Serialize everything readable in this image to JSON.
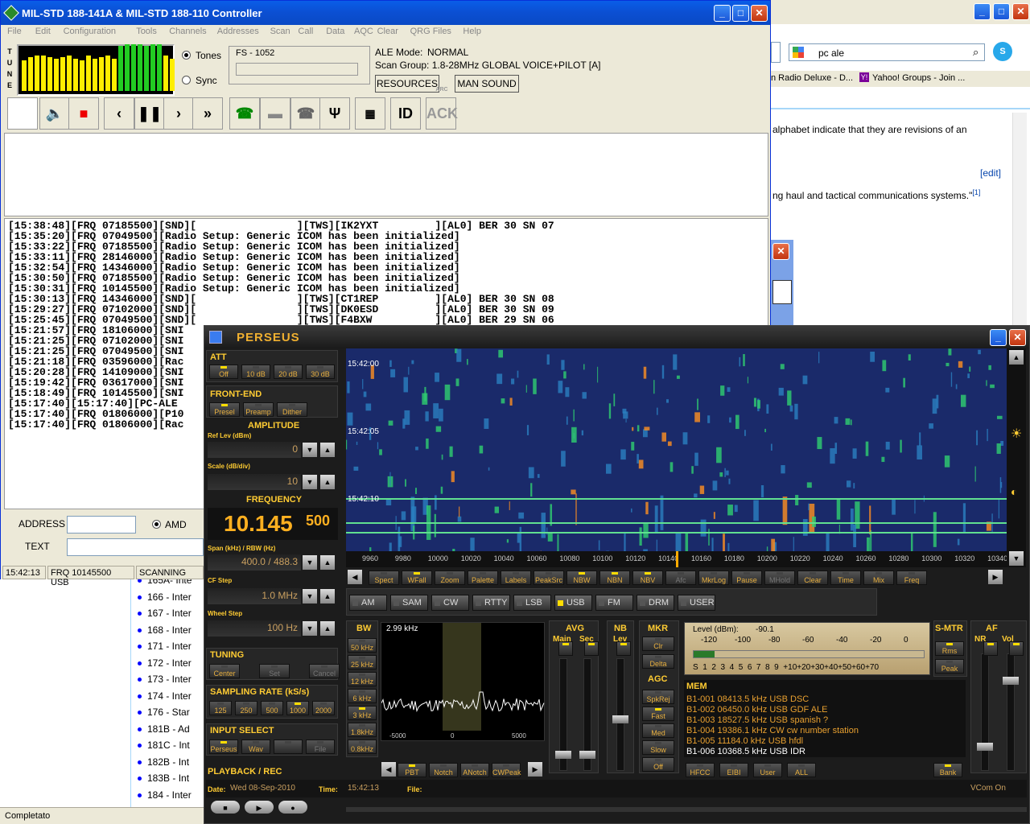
{
  "mil_window": {
    "title": "MIL-STD 188-141A & MIL-STD 188-110 Controller",
    "menu": [
      "File",
      "Edit",
      "Configuration",
      "Tools",
      "Channels",
      "Addresses",
      "Scan",
      "Call",
      "Data",
      "AQC",
      "Clear",
      "QRG Files",
      "Help"
    ],
    "tune_label": "T U N E",
    "tones_label": "Tones",
    "sync_label": "Sync",
    "fs_label": "FS - 1052",
    "ale_mode_label": "ALE Mode:",
    "ale_mode_value": "NORMAL",
    "scan_group": "Scan Group: 1.8-28MHz GLOBAL VOICE+PILOT [A]",
    "resources_btn": "RESOURCES",
    "man_sound_btn": "MAN SOUND",
    "id_btn": "ID",
    "ack_btn": "ACK",
    "ack_caption": "ARC",
    "log_lines": [
      "[15:38:48][FRQ 07185500][SND][                ][TWS][IK2YXT         ][AL0] BER 30 SN 07",
      "[15:35:20][FRQ 07049500][Radio Setup: Generic ICOM has been initialized]",
      "[15:33:22][FRQ 07185500][Radio Setup: Generic ICOM has been initialized]",
      "[15:33:11][FRQ 28146000][Radio Setup: Generic ICOM has been initialized]",
      "[15:32:54][FRQ 14346000][Radio Setup: Generic ICOM has been initialized]",
      "[15:30:50][FRQ 07185500][Radio Setup: Generic ICOM has been initialized]",
      "[15:30:31][FRQ 10145500][Radio Setup: Generic ICOM has been initialized]",
      "[15:30:13][FRQ 14346000][SND][                ][TWS][CT1REP         ][AL0] BER 30 SN 08",
      "[15:29:27][FRQ 07102000][SND][                ][TWS][DK0ESD         ][AL0] BER 30 SN 09",
      "[15:25:45][FRQ 07049500][SND][                ][TWS][F4BXW          ][AL0] BER 29 SN 06",
      "[15:21:57][FRQ 18106000][SNI",
      "[15:21:25][FRQ 07102000][SNI",
      "[15:21:25][FRQ 07049500][SNI",
      "[15:21:18][FRQ 03596000][Rac",
      "[15:20:28][FRQ 14109000][SNI",
      "[15:19:42][FRQ 03617000][SNI",
      "[15:18:49][FRQ 10145500][SNI",
      "[15:17:40][15:17:40][PC-ALE",
      "[15:17:40][FRQ 01806000][P10",
      "[15:17:40][FRQ 01806000][Rac"
    ],
    "address_label": "ADDRESS",
    "text_label": "TEXT",
    "amd_label": "AMD",
    "status": [
      "15:42:13",
      "FRQ 10145500 USB",
      "SCANNING"
    ]
  },
  "browser": {
    "search_value": "pc ale",
    "links": [
      "n Radio Deluxe - D...",
      "Yahoo! Groups - Join ..."
    ],
    "page_text_1": "alphabet indicate that they are revisions of an",
    "edit_link": "[edit]",
    "page_text_2": "ng haul and tactical communications systems.\"",
    "footnote": "[1]",
    "list_items": [
      "165A- Inte",
      "166 - Inter",
      "167 - Inter",
      "168 - Inter",
      "171 - Inter",
      "172 - Inter",
      "173 - Inter",
      "174 - Inter",
      "176 - Star",
      "181B - Ad",
      "181C - Int",
      "182B - Int",
      "183B - Int",
      "184 - Inter"
    ],
    "status_text": "Completato"
  },
  "perseus": {
    "title": "PERSEUS",
    "att_label": "ATT",
    "att_btns": [
      "Off",
      "10 dB",
      "20 dB",
      "30 dB"
    ],
    "frontend_label": "FRONT-END",
    "frontend_btns": [
      "Presel",
      "Preamp",
      "Dither"
    ],
    "amplitude_label": "AMPLITUDE",
    "ref_lev_label": "Ref Lev (dBm)",
    "ref_lev_value": "0",
    "scale_label": "Scale (dB/div)",
    "scale_value": "10",
    "frequency_label": "FREQUENCY",
    "freq_main": "10.145",
    "freq_sub": "500",
    "span_label": "Span (kHz) / RBW (Hz)",
    "span_value": "400.0 / 488.3",
    "cf_step_label": "CF Step",
    "cf_step_value": "1.0 MHz",
    "wheel_step_label": "Wheel Step",
    "wheel_step_value": "100 Hz",
    "tuning_label": "TUNING",
    "tuning_btns": [
      "Center",
      "Set",
      "Cancel"
    ],
    "sampling_label": "SAMPLING RATE (kS/s)",
    "sampling_btns": [
      "125",
      "250",
      "500",
      "1000",
      "2000"
    ],
    "input_label": "INPUT SELECT",
    "input_btns": [
      "Perseus",
      "Wav",
      "",
      "File"
    ],
    "playback_label": "PLAYBACK / REC",
    "date_label": "Date:",
    "date_value": "Wed 08-Sep-2010",
    "time_label": "Time:",
    "time_value": "15:42:13",
    "file_label": "File:",
    "vcom": "VCom On",
    "wf_times": [
      "15:42:00",
      "15:42:05",
      "15:42:10"
    ],
    "axis_ticks": [
      "9960",
      "9980",
      "10000",
      "10020",
      "10040",
      "10060",
      "10080",
      "10100",
      "10120",
      "10140",
      "10160",
      "10180",
      "10200",
      "10220",
      "10240",
      "10260",
      "10280",
      "10300",
      "10320",
      "10340"
    ],
    "wf_btns": [
      "Spect",
      "WFall",
      "Zoom",
      "Palette",
      "Labels",
      "PeakSrc",
      "NBW",
      "NBN",
      "NBV",
      "Afc",
      "MkrLog",
      "Pause",
      "MHold",
      "Clear",
      "Time",
      "Mix",
      "Freq"
    ],
    "modes": [
      "AM",
      "SAM",
      "CW",
      "RTTY",
      "LSB",
      "USB",
      "FM",
      "DRM",
      "USER"
    ],
    "active_mode": "USB",
    "bw_label": "BW",
    "bw_value": "2.99 kHz",
    "bw_btns": [
      "50 kHz",
      "25 kHz",
      "12 kHz",
      "6 kHz",
      "3 kHz",
      "1.8kHz",
      "0.8kHz"
    ],
    "spec_ticks": [
      "-5000",
      "0",
      "5000"
    ],
    "spec_btns": [
      "PBT",
      "Notch",
      "ANotch",
      "CWPeak"
    ],
    "avg_label": "AVG",
    "avg_main": "Main",
    "avg_sec": "Sec",
    "nb_label": "NB",
    "nb_lev": "Lev",
    "mkr_label": "MKR",
    "mkr_btns": [
      "Clr",
      "Delta"
    ],
    "agc_label": "AGC",
    "agc_btns": [
      "SpkRej",
      "Fast",
      "Med",
      "Slow",
      "Off"
    ],
    "level_label": "Level (dBm):",
    "level_value": "-90.1",
    "smeter_scale": [
      "-120",
      "-100",
      "-80",
      "-60",
      "-40",
      "-20",
      "0"
    ],
    "smeter_s": "S  1  2  3  4  5  6  7  8  9  +10+20+30+40+50+60+70",
    "smtr_label": "S-MTR",
    "smtr_btns": [
      "Rms",
      "Peak"
    ],
    "af_label": "AF",
    "nr_label": "NR",
    "vol_label": "Vol",
    "mem_label": "MEM",
    "mem_rows": [
      "B1-001 08413.5 kHz USB  DSC",
      "B1-002 06450.0 kHz USB  GDF ALE",
      "B1-003 18527.5 kHz USB  spanish ?",
      "B1-004 19386.1 kHz  CW  cw number station",
      "B1-005 11184.0 kHz USB  hfdl",
      "B1-006 10368.5 kHz USB  IDR"
    ],
    "mem_btns": [
      "HFCC",
      "EIBI",
      "User",
      "ALL"
    ],
    "bank_btn": "Bank"
  }
}
